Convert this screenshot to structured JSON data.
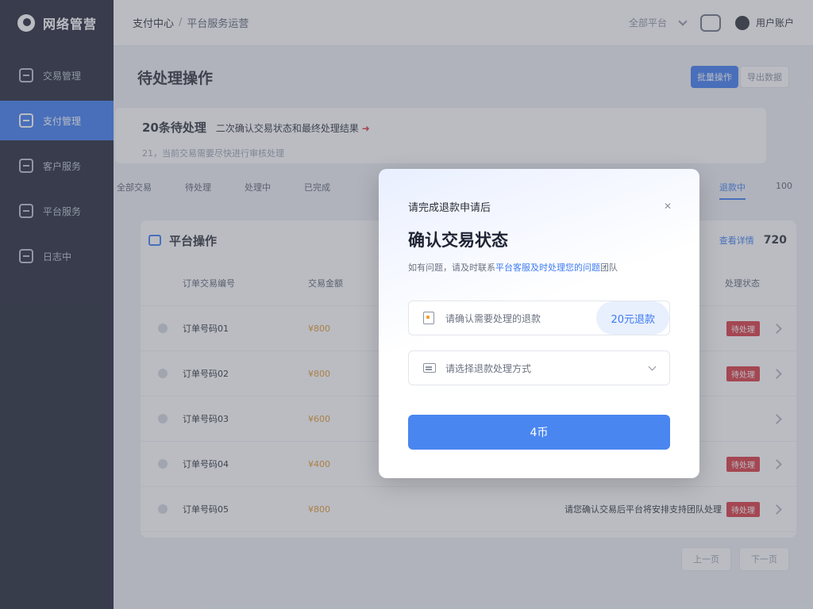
{
  "app": {
    "name": "网络管营"
  },
  "sidebar": {
    "items": [
      {
        "label": "交易管理",
        "icon": "dashboard-icon",
        "active": false
      },
      {
        "label": "支付管理",
        "icon": "wallet-icon",
        "active": true
      },
      {
        "label": "客户服务",
        "icon": "support-icon",
        "active": false
      },
      {
        "label": "平台服务",
        "icon": "platform-icon",
        "active": false
      },
      {
        "label": "日志中",
        "icon": "log-icon",
        "active": false
      }
    ]
  },
  "topbar": {
    "crumb": "支付中心",
    "crumb_sub": "平台服务运营",
    "select_label": "全部平台",
    "user_name": "用户账户"
  },
  "page": {
    "title": "待处理操作",
    "primary_btn": "批量操作",
    "ghost_btn": "导出数据"
  },
  "notice": {
    "title": "20条待处理",
    "text": "二次确认交易状态和最终处理结果",
    "arrow": "➜",
    "sub": "21，当前交易需要尽快进行审核处理"
  },
  "tabs": [
    "全部交易",
    "待处理",
    "处理中",
    "已完成"
  ],
  "tabs_right": [
    "退款中",
    "100"
  ],
  "panel": {
    "title": "平台操作",
    "link": "查看详情",
    "count": "720",
    "columns": [
      "订单交易编号",
      "交易金额",
      "处理状态"
    ],
    "rows": [
      {
        "name": "订单号码01",
        "amount": "¥800",
        "note": "",
        "tag": "待处理"
      },
      {
        "name": "订单号码02",
        "amount": "¥800",
        "note": "",
        "tag": "待处理"
      },
      {
        "name": "订单号码03",
        "amount": "¥600",
        "note": "",
        "tag": ""
      },
      {
        "name": "订单号码04",
        "amount": "¥400",
        "note": "",
        "tag": "待处理"
      },
      {
        "name": "订单号码05",
        "amount": "¥800",
        "note": "请您确认交易后平台将安排支持团队处理",
        "tag": "待处理"
      }
    ]
  },
  "pager": {
    "prev": "上一页",
    "next": "下一页"
  },
  "modal": {
    "kicker": "请完成退款申请后",
    "close": "✕",
    "title": "确认交易状态",
    "desc_prefix": "如有问题，请及时联系",
    "desc_link": "平台客服及时处理您的问题",
    "desc_suffix": "团队",
    "field_text": "请确认需要处理的退款",
    "field_action": "20元退款",
    "select_text": "请选择退款处理方式",
    "submit": "4币"
  },
  "colors": {
    "accent": "#3d7bf2",
    "sidebar_bg": "#1f2434",
    "tag_red": "#d9363e",
    "amount_orange": "#e5972c"
  }
}
